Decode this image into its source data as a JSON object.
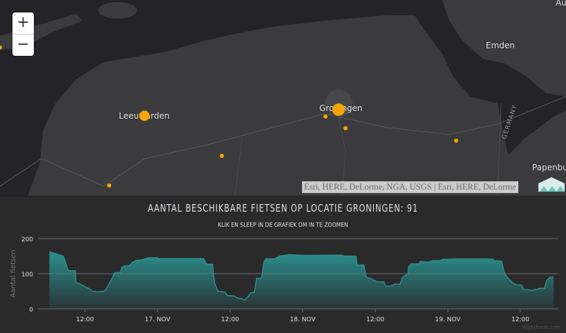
{
  "map": {
    "zoom_in": "+",
    "zoom_out": "−",
    "labels": [
      {
        "text": "Leeuwarden"
      },
      {
        "text": "Groningen"
      },
      {
        "text": "Emden"
      },
      {
        "text": "Papenbu"
      },
      {
        "text": "Au"
      },
      {
        "text": "GERMANY"
      }
    ],
    "attribution": "Esri, HERE, DeLorme, NGA, USGS | Esri, HERE, DeLorme",
    "marker_color": "#f7a600"
  },
  "chart_data": {
    "type": "area",
    "title": "AANTAL BESCHIKBARE FIETSEN OP LOCATIE GRONINGEN: 91",
    "subtitle": "KLIK EN SLEEP IN DE GRAFIEK OM IN TE ZOOMEN",
    "ylabel": "Aantal fietsen",
    "ylim": [
      0,
      200
    ],
    "yticks": [
      "0",
      "100",
      "200"
    ],
    "xunit": "hours since 16 Nov 00:00",
    "xticks": [
      {
        "h": 12,
        "label": "12:00"
      },
      {
        "h": 24,
        "label": "17. NOV"
      },
      {
        "h": 36,
        "label": "12:00"
      },
      {
        "h": 48,
        "label": "18. NOV"
      },
      {
        "h": 60,
        "label": "12:00"
      },
      {
        "h": 72,
        "label": "19. NOV"
      },
      {
        "h": 84,
        "label": "12:00"
      }
    ],
    "x": [
      6.1,
      7.5,
      8.4,
      8.7,
      9.1,
      9.3,
      10.4,
      10.5,
      11.1,
      12.0,
      12.6,
      13.2,
      14.1,
      15.2,
      15.8,
      16.4,
      16.9,
      17.8,
      18.1,
      18.5,
      19.3,
      19.7,
      20.3,
      21.5,
      22.4,
      23.9,
      24.2,
      31.6,
      32.1,
      33.1,
      33.4,
      34.0,
      35.2,
      35.5,
      36.7,
      37.3,
      37.9,
      38.4,
      39.1,
      39.4,
      40.0,
      40.4,
      41.2,
      41.6,
      42.0,
      43.3,
      44.2,
      45.7,
      48.7,
      54.3,
      54.9,
      56.8,
      57.0,
      58.1,
      58.5,
      59.4,
      60.2,
      61.4,
      61.7,
      62.6,
      63.2,
      64.1,
      64.5,
      65.4,
      65.5,
      66.0,
      67.2,
      67.5,
      68.6,
      69.5,
      70.7,
      71.3,
      73.1,
      79.4,
      79.7,
      80.9,
      81.3,
      81.8,
      82.7,
      83.3,
      84.2,
      84.5,
      86.0,
      86.6,
      87.1,
      88.0,
      88.3,
      88.9,
      89.5
    ],
    "values": [
      163,
      155,
      150,
      137,
      115,
      108,
      108,
      75,
      72,
      63,
      58,
      50,
      48,
      50,
      65,
      85,
      103,
      103,
      118,
      122,
      123,
      130,
      137,
      140,
      145,
      145,
      143,
      143,
      127,
      127,
      75,
      50,
      47,
      38,
      37,
      30,
      29,
      25,
      37,
      46,
      46,
      87,
      87,
      135,
      143,
      142,
      150,
      154,
      152,
      153,
      150,
      150,
      125,
      125,
      90,
      85,
      77,
      77,
      64,
      65,
      70,
      70,
      90,
      100,
      120,
      128,
      128,
      135,
      133,
      137,
      137,
      141,
      142,
      142,
      137,
      136,
      105,
      90,
      75,
      68,
      68,
      55,
      53,
      55,
      58,
      58,
      80,
      90,
      91
    ],
    "color": "#2b908f",
    "credit": "Highcharts.com"
  }
}
